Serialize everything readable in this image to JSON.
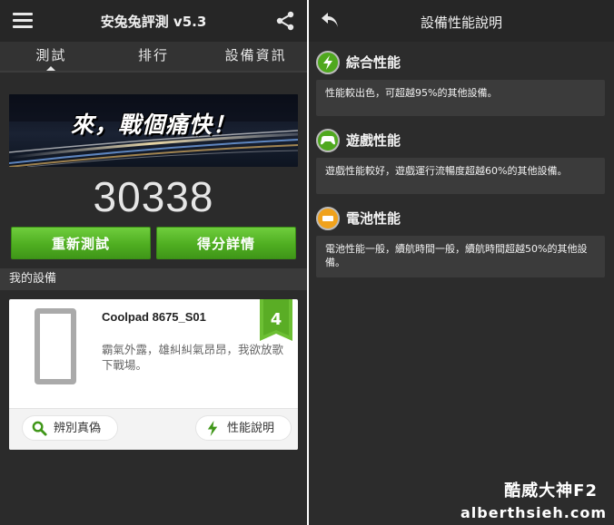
{
  "left": {
    "app_title": "安兔兔評測 v5.3",
    "tabs": [
      {
        "label": "測試",
        "active": true
      },
      {
        "label": "排行",
        "active": false
      },
      {
        "label": "設備資訊",
        "active": false
      }
    ],
    "banner_text": "來，戰個痛快！",
    "score": "30338",
    "retest_label": "重新測試",
    "detail_label": "得分詳情",
    "section_title": "我的設備",
    "device": {
      "name": "Coolpad 8675_S01",
      "rank": "4",
      "description": "霸氣外露，雄糾糾氣昂昂，我欲放歌下戰場。",
      "verify_label": "辨別真偽",
      "perf_label": "性能說明"
    }
  },
  "right": {
    "title": "設備性能說明",
    "categories": [
      {
        "label": "綜合性能",
        "icon": "lightning-icon",
        "color": "#4fa81e",
        "description": "性能較出色，可超越95%的其他設備。"
      },
      {
        "label": "遊戲性能",
        "icon": "gamepad-icon",
        "color": "#4fa81e",
        "description": "遊戲性能較好，遊戲運行流暢度超越60%的其他設備。"
      },
      {
        "label": "電池性能",
        "icon": "battery-icon",
        "color": "#f0a21c",
        "description": "電池性能一般，續航時間一般，續航時間超越50%的其他設備。"
      }
    ]
  },
  "watermark": {
    "line1": "酷威大神F2",
    "line2": "alberthsieh.com"
  },
  "colors": {
    "green": "#52b023",
    "orange": "#f0a21c",
    "dark_bg": "#2b2b2b"
  }
}
